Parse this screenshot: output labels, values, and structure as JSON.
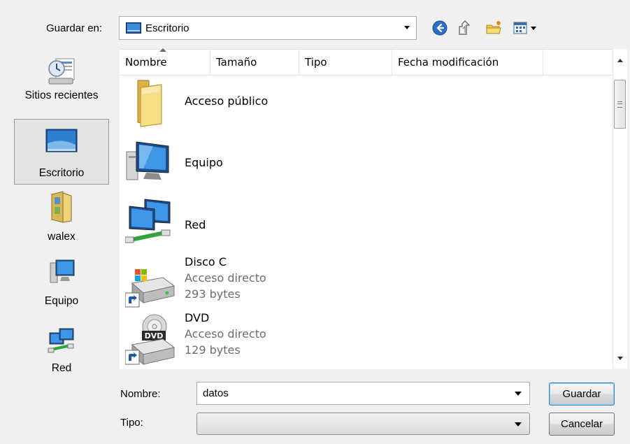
{
  "dialog": {
    "save_in_label": "Guardar en:",
    "location": "Escritorio"
  },
  "toolbar": {
    "icons": [
      "back-icon",
      "up-folder-icon",
      "new-folder-icon",
      "view-menu-icon"
    ]
  },
  "places": [
    {
      "label": "Sitios recientes",
      "icon": "recent-places-icon"
    },
    {
      "label": "Escritorio",
      "icon": "desktop-icon",
      "selected": true
    },
    {
      "label": "walex",
      "icon": "user-folder-icon"
    },
    {
      "label": "Equipo",
      "icon": "computer-icon"
    },
    {
      "label": "Red",
      "icon": "network-icon"
    }
  ],
  "columns": [
    "Nombre",
    "Tamaño",
    "Tipo",
    "Fecha modificación"
  ],
  "files": [
    {
      "name": "Acceso público",
      "icon": "folder-icon"
    },
    {
      "name": "Equipo",
      "icon": "computer-icon"
    },
    {
      "name": "Red",
      "icon": "network-icon"
    },
    {
      "name": "Disco C",
      "type": "Acceso directo",
      "size": "293 bytes",
      "icon": "drive-shortcut-icon"
    },
    {
      "name": "DVD",
      "type": "Acceso directo",
      "size": "129 bytes",
      "icon": "dvd-shortcut-icon"
    }
  ],
  "form": {
    "filename_label": "Nombre:",
    "filename_value": "datos",
    "filetype_label": "Tipo:",
    "filetype_value": ""
  },
  "buttons": {
    "save": "Guardar",
    "cancel": "Cancelar"
  },
  "colors": {
    "dialog_bg": "#f0f0f0",
    "selected_place_bg": "#e3e3e3",
    "save_button_border": "#3c7fb1"
  }
}
